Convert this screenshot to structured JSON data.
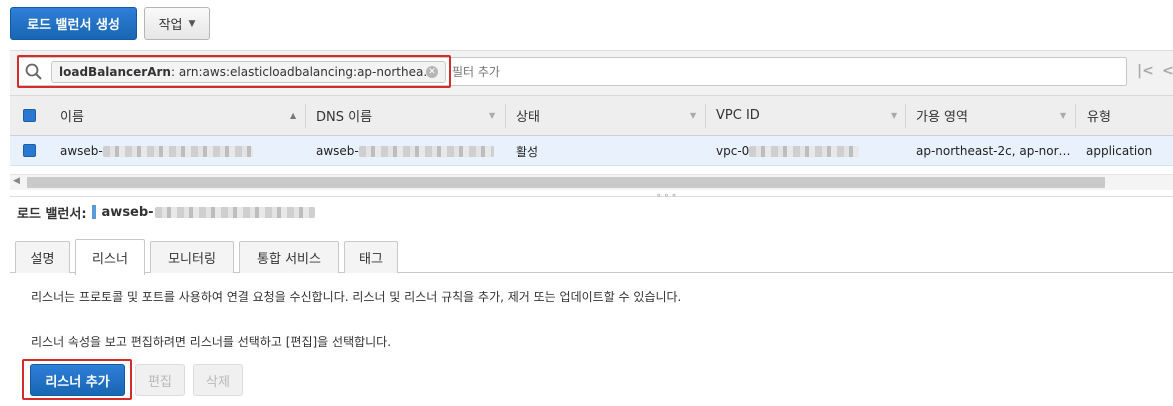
{
  "toolbar": {
    "create_label": "로드 밸런서 생성",
    "actions_label": "작업"
  },
  "filter": {
    "token_key": "loadBalancerArn",
    "token_value": " : arn:aws:elasticloadbalancing:ap-northea…",
    "placeholder": "필터 추가"
  },
  "table": {
    "columns": [
      "이름",
      "DNS 이름",
      "상태",
      "VPC ID",
      "가용 영역",
      "유형"
    ],
    "row": {
      "name": "awseb-",
      "dns": "awseb-",
      "state": "활성",
      "vpc": "vpc-0",
      "az": "ap-northeast-2c, ap-nor…",
      "type": "application"
    }
  },
  "detail": {
    "title_label": "로드 밸런서:",
    "title_value": "awseb-",
    "tabs": [
      "설명",
      "리스너",
      "모니터링",
      "통합 서비스",
      "태그"
    ],
    "active_tab": "리스너",
    "desc1": "리스너는 프로토콜 및 포트를 사용하여 연결 요청을 수신합니다. 리스너 및 리스너 규칙을 추가, 제거 또는 업데이트할 수 있습니다.",
    "desc2": "리스너 속성을 보고 편집하려면 리스너를 선택하고 [편집]을 선택합니다.",
    "add_label": "리스너 추가",
    "edit_label": "편집",
    "delete_label": "삭제"
  },
  "icons": {
    "search": "search-icon",
    "clear": "clear-token-icon",
    "first_page": "first-page-icon",
    "prev_page": "prev-page-icon"
  },
  "colors": {
    "primary": "#1f6fc5",
    "highlight": "#d62b2b",
    "selected_row": "#e8f1fc"
  }
}
